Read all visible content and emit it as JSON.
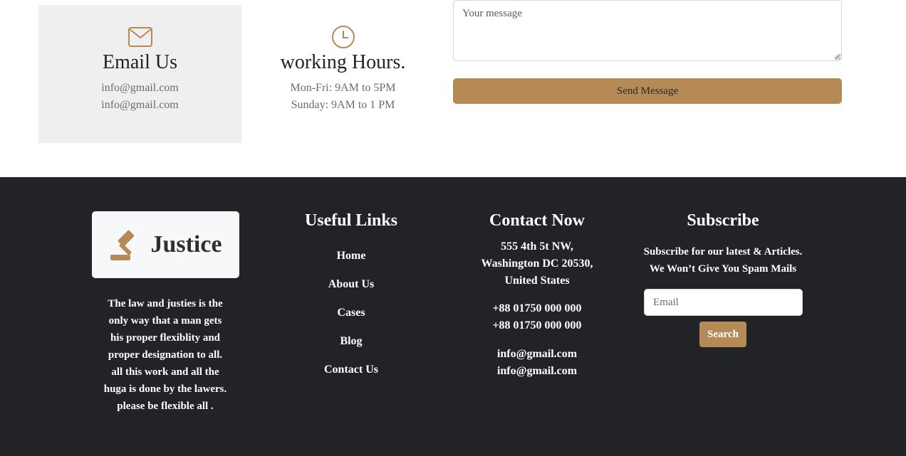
{
  "contact_cards": {
    "email": {
      "icon": "envelope-icon",
      "title": "Email Us",
      "line1": "info@gmail.com",
      "line2": "info@gmail.com"
    },
    "hours": {
      "icon": "clock-icon",
      "title": "working Hours.",
      "line1": "Mon-Fri: 9AM to 5PM",
      "line2": "Sunday: 9AM to 1 PM"
    }
  },
  "form": {
    "message_placeholder": "Your message",
    "send_label": "Send Message"
  },
  "footer": {
    "logo": {
      "icon": "gavel-icon",
      "text": "Justice"
    },
    "about_lines": [
      "The law and justies is the",
      "only way that a man gets",
      "his proper flexiblity and",
      "proper designation to all.",
      "all this work and all the",
      "huga is done by the lawers.",
      "please be flexible all ."
    ],
    "useful_links": {
      "title": "Useful Links",
      "items": [
        "Home",
        "About Us",
        "Cases",
        "Blog",
        "Contact Us"
      ]
    },
    "contact": {
      "title": "Contact Now",
      "address_lines": [
        "555 4th 5t NW,",
        "Washington DC 20530,",
        "United States"
      ],
      "phones": [
        "+88 01750 000 000",
        "+88 01750 000 000"
      ],
      "emails": [
        "info@gmail.com",
        "info@gmail.com"
      ]
    },
    "subscribe": {
      "title": "Subscribe",
      "text_lines": [
        "Subscribe for our latest & Articles.",
        "We Won’t Give You Spam Mails"
      ],
      "email_placeholder": "Email",
      "button_label": "Search"
    }
  },
  "colors": {
    "accent": "#b58a57",
    "footer_bg": "#212327",
    "card_bg": "#efefef"
  }
}
